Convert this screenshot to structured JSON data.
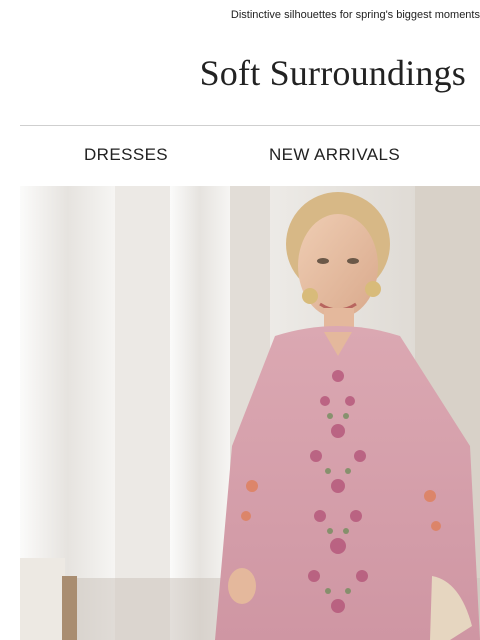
{
  "promo": {
    "text": "Distinctive silhouettes for spring's biggest moments"
  },
  "brand": {
    "logo_text": "Soft Surroundings"
  },
  "nav": {
    "items": [
      {
        "label": "DRESSES"
      },
      {
        "label": "NEW ARRIVALS"
      }
    ]
  },
  "hero": {
    "image_name": "model-in-pink-embroidered-dress-photo"
  }
}
